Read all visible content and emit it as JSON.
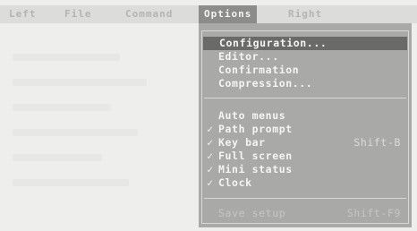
{
  "menubar": {
    "items": [
      {
        "label": "Left"
      },
      {
        "label": "File"
      },
      {
        "label": "Command"
      },
      {
        "label": "Options"
      },
      {
        "label": "Right"
      }
    ]
  },
  "options_menu": {
    "items": [
      {
        "label": "Configuration...",
        "checked": false
      },
      {
        "label": "Editor...",
        "checked": false
      },
      {
        "label": "Confirmation",
        "checked": false
      },
      {
        "label": "Compression...",
        "checked": false
      },
      {
        "label": "Auto menus",
        "checked": false
      },
      {
        "label": "Path prompt",
        "checked": true
      },
      {
        "label": "Key bar",
        "checked": true,
        "shortcut": "Shift-B"
      },
      {
        "label": "Full screen",
        "checked": true
      },
      {
        "label": "Mini status",
        "checked": true
      },
      {
        "label": "Clock",
        "checked": true
      },
      {
        "label": "Save setup",
        "checked": false,
        "shortcut": "Shift-F9"
      }
    ],
    "check_glyph": "✓"
  },
  "colors": {
    "menubar_bg": "#dcdcda",
    "active_tab_bg": "#8c8c8a",
    "dropdown_bg": "#a9a9a7",
    "highlight_bg": "#6a6a68",
    "menu_text": "#f4f4f2"
  }
}
